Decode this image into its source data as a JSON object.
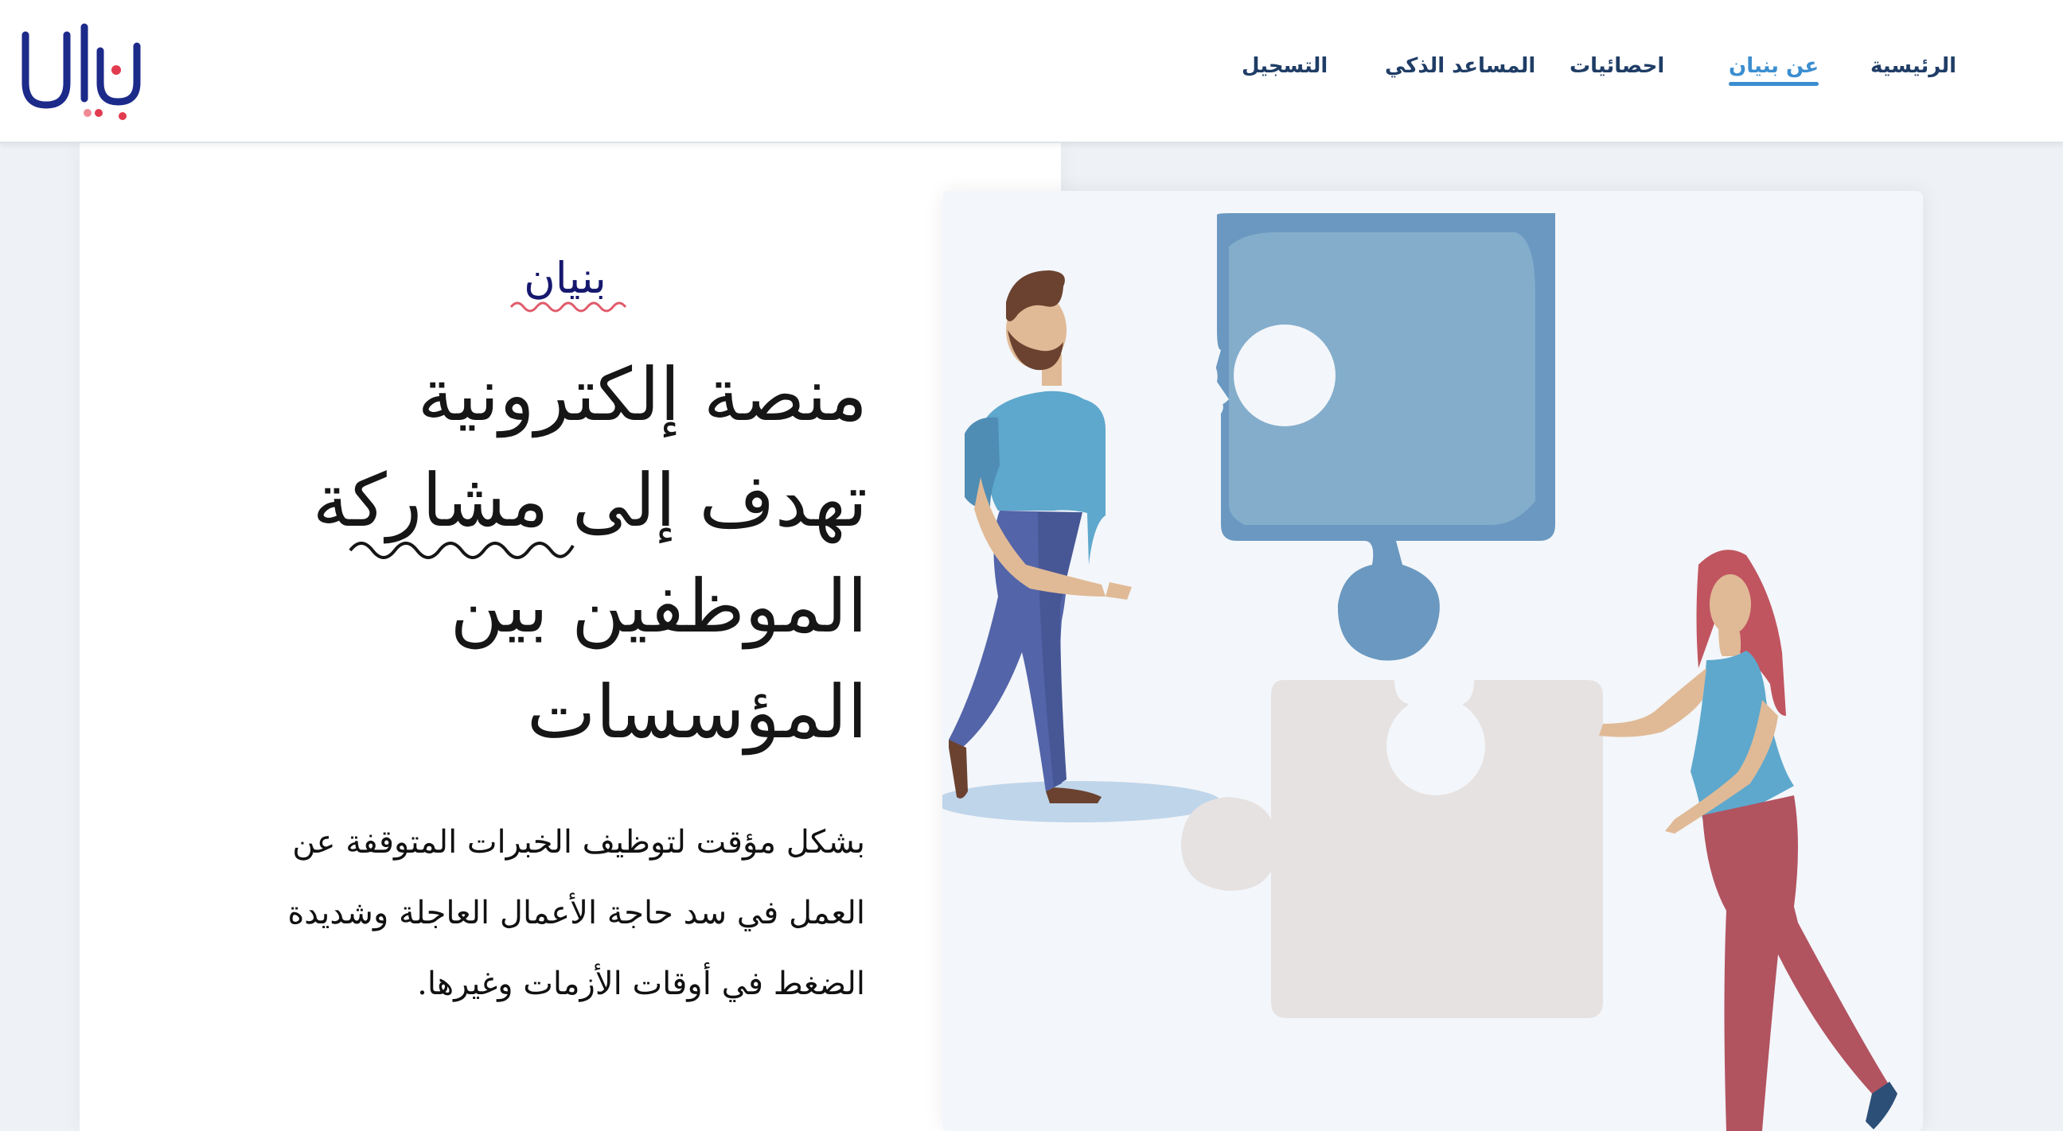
{
  "header": {
    "logo_text": "بنيان",
    "nav": [
      {
        "label": "الرئيسية",
        "active": false
      },
      {
        "label": "عن بنيان",
        "active": true
      },
      {
        "label": "احصائيات",
        "active": false
      },
      {
        "label": "المساعد الذكي",
        "active": false
      },
      {
        "label": "التسجيل",
        "active": false
      }
    ]
  },
  "hero": {
    "brand": "بنيان",
    "headline": "منصة إلكترونية تهدف إلى مشاركة الموظفين بين المؤسسات",
    "description": "بشكل مؤقت لتوظيف الخبرات المتوقفة عن العمل في سد حاجة الأعمال العاجلة وشديدة الضغط في أوقات الأزمات وغيرها."
  },
  "colors": {
    "nav_text": "#1f3d66",
    "nav_active": "#3b8ed0",
    "brand_navy": "#16186e",
    "logo_dot_red": "#e23b4f",
    "puzzle_blue": "#6a98c0",
    "puzzle_grey": "#e6e2e1"
  },
  "icons": {
    "logo": "bunyan-logo",
    "illustration": "two-people-assembling-puzzle-pieces"
  }
}
